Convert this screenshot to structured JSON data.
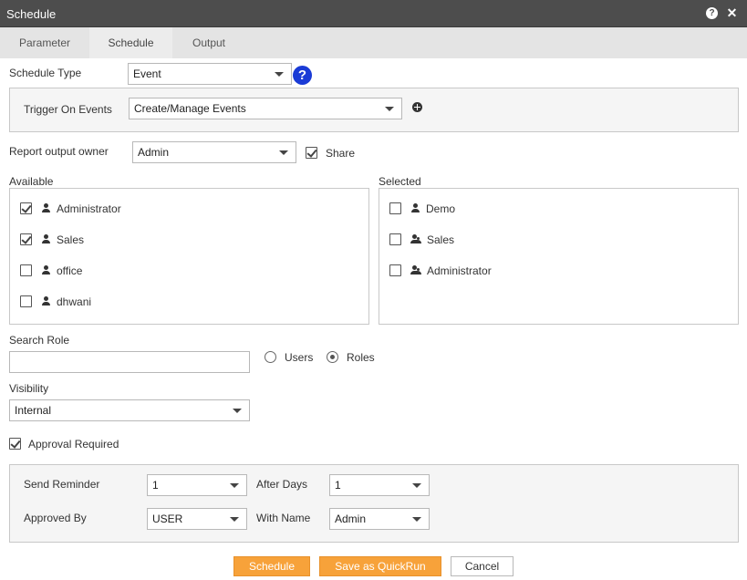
{
  "window": {
    "title": "Schedule"
  },
  "tabs": [
    {
      "label": "Parameter"
    },
    {
      "label": "Schedule"
    },
    {
      "label": "Output"
    }
  ],
  "schedule_type": {
    "label": "Schedule Type",
    "value": "Event"
  },
  "trigger": {
    "label": "Trigger On Events",
    "value": "Create/Manage Events"
  },
  "owner": {
    "label": "Report output owner",
    "value": "Admin",
    "share_label": "Share",
    "share_checked": true
  },
  "available": {
    "label": "Available",
    "items": [
      {
        "label": "Administrator",
        "checked": true,
        "icon": "user-icon"
      },
      {
        "label": "Sales",
        "checked": true,
        "icon": "user-icon"
      },
      {
        "label": "office",
        "checked": false,
        "icon": "user-icon"
      },
      {
        "label": "dhwani",
        "checked": false,
        "icon": "user-icon"
      }
    ]
  },
  "selected": {
    "label": "Selected",
    "items": [
      {
        "label": "Demo",
        "checked": false,
        "icon": "user-icon"
      },
      {
        "label": "Sales",
        "checked": false,
        "icon": "group-icon"
      },
      {
        "label": "Administrator",
        "checked": false,
        "icon": "group-icon"
      }
    ]
  },
  "search_role": {
    "label": "Search Role",
    "value": "",
    "placeholder": ""
  },
  "mode": {
    "users_label": "Users",
    "roles_label": "Roles",
    "selected": "Roles"
  },
  "visibility": {
    "label": "Visibility",
    "value": "Internal"
  },
  "approval": {
    "label": "Approval Required",
    "checked": true
  },
  "reminder": {
    "send_label": "Send Reminder",
    "send_value": "1",
    "after_label": "After Days",
    "after_value": "1",
    "approved_label": "Approved By",
    "approved_value": "USER",
    "with_label": "With Name",
    "with_value": "Admin"
  },
  "buttons": {
    "schedule": "Schedule",
    "quickrun": "Save as QuickRun",
    "cancel": "Cancel"
  },
  "colors": {
    "accent": "#f7a23a",
    "titlebar": "#4d4d4d",
    "help": "#1a3bd6"
  }
}
